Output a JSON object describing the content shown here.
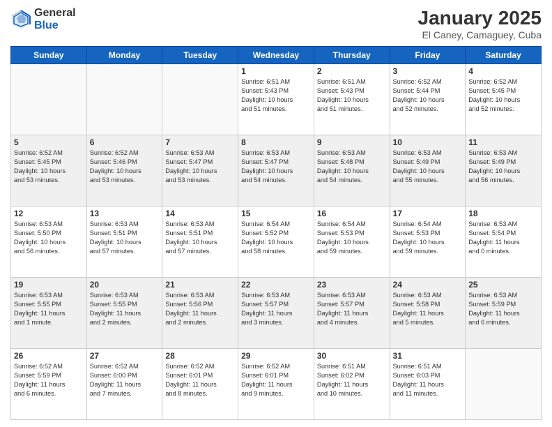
{
  "header": {
    "logo_general": "General",
    "logo_blue": "Blue",
    "month_title": "January 2025",
    "location": "El Caney, Camaguey, Cuba"
  },
  "weekdays": [
    "Sunday",
    "Monday",
    "Tuesday",
    "Wednesday",
    "Thursday",
    "Friday",
    "Saturday"
  ],
  "weeks": [
    [
      {
        "day": "",
        "info": ""
      },
      {
        "day": "",
        "info": ""
      },
      {
        "day": "",
        "info": ""
      },
      {
        "day": "1",
        "info": "Sunrise: 6:51 AM\nSunset: 5:43 PM\nDaylight: 10 hours\nand 51 minutes."
      },
      {
        "day": "2",
        "info": "Sunrise: 6:51 AM\nSunset: 5:43 PM\nDaylight: 10 hours\nand 51 minutes."
      },
      {
        "day": "3",
        "info": "Sunrise: 6:52 AM\nSunset: 5:44 PM\nDaylight: 10 hours\nand 52 minutes."
      },
      {
        "day": "4",
        "info": "Sunrise: 6:52 AM\nSunset: 5:45 PM\nDaylight: 10 hours\nand 52 minutes."
      }
    ],
    [
      {
        "day": "5",
        "info": "Sunrise: 6:52 AM\nSunset: 5:45 PM\nDaylight: 10 hours\nand 53 minutes."
      },
      {
        "day": "6",
        "info": "Sunrise: 6:52 AM\nSunset: 5:46 PM\nDaylight: 10 hours\nand 53 minutes."
      },
      {
        "day": "7",
        "info": "Sunrise: 6:53 AM\nSunset: 5:47 PM\nDaylight: 10 hours\nand 53 minutes."
      },
      {
        "day": "8",
        "info": "Sunrise: 6:53 AM\nSunset: 5:47 PM\nDaylight: 10 hours\nand 54 minutes."
      },
      {
        "day": "9",
        "info": "Sunrise: 6:53 AM\nSunset: 5:48 PM\nDaylight: 10 hours\nand 54 minutes."
      },
      {
        "day": "10",
        "info": "Sunrise: 6:53 AM\nSunset: 5:49 PM\nDaylight: 10 hours\nand 55 minutes."
      },
      {
        "day": "11",
        "info": "Sunrise: 6:53 AM\nSunset: 5:49 PM\nDaylight: 10 hours\nand 56 minutes."
      }
    ],
    [
      {
        "day": "12",
        "info": "Sunrise: 6:53 AM\nSunset: 5:50 PM\nDaylight: 10 hours\nand 56 minutes."
      },
      {
        "day": "13",
        "info": "Sunrise: 6:53 AM\nSunset: 5:51 PM\nDaylight: 10 hours\nand 57 minutes."
      },
      {
        "day": "14",
        "info": "Sunrise: 6:53 AM\nSunset: 5:51 PM\nDaylight: 10 hours\nand 57 minutes."
      },
      {
        "day": "15",
        "info": "Sunrise: 6:54 AM\nSunset: 5:52 PM\nDaylight: 10 hours\nand 58 minutes."
      },
      {
        "day": "16",
        "info": "Sunrise: 6:54 AM\nSunset: 5:53 PM\nDaylight: 10 hours\nand 59 minutes."
      },
      {
        "day": "17",
        "info": "Sunrise: 6:54 AM\nSunset: 5:53 PM\nDaylight: 10 hours\nand 59 minutes."
      },
      {
        "day": "18",
        "info": "Sunrise: 6:53 AM\nSunset: 5:54 PM\nDaylight: 11 hours\nand 0 minutes."
      }
    ],
    [
      {
        "day": "19",
        "info": "Sunrise: 6:53 AM\nSunset: 5:55 PM\nDaylight: 11 hours\nand 1 minute."
      },
      {
        "day": "20",
        "info": "Sunrise: 6:53 AM\nSunset: 5:55 PM\nDaylight: 11 hours\nand 2 minutes."
      },
      {
        "day": "21",
        "info": "Sunrise: 6:53 AM\nSunset: 5:56 PM\nDaylight: 11 hours\nand 2 minutes."
      },
      {
        "day": "22",
        "info": "Sunrise: 6:53 AM\nSunset: 5:57 PM\nDaylight: 11 hours\nand 3 minutes."
      },
      {
        "day": "23",
        "info": "Sunrise: 6:53 AM\nSunset: 5:57 PM\nDaylight: 11 hours\nand 4 minutes."
      },
      {
        "day": "24",
        "info": "Sunrise: 6:53 AM\nSunset: 5:58 PM\nDaylight: 11 hours\nand 5 minutes."
      },
      {
        "day": "25",
        "info": "Sunrise: 6:53 AM\nSunset: 5:59 PM\nDaylight: 11 hours\nand 6 minutes."
      }
    ],
    [
      {
        "day": "26",
        "info": "Sunrise: 6:52 AM\nSunset: 5:59 PM\nDaylight: 11 hours\nand 6 minutes."
      },
      {
        "day": "27",
        "info": "Sunrise: 6:52 AM\nSunset: 6:00 PM\nDaylight: 11 hours\nand 7 minutes."
      },
      {
        "day": "28",
        "info": "Sunrise: 6:52 AM\nSunset: 6:01 PM\nDaylight: 11 hours\nand 8 minutes."
      },
      {
        "day": "29",
        "info": "Sunrise: 6:52 AM\nSunset: 6:01 PM\nDaylight: 11 hours\nand 9 minutes."
      },
      {
        "day": "30",
        "info": "Sunrise: 6:51 AM\nSunset: 6:02 PM\nDaylight: 11 hours\nand 10 minutes."
      },
      {
        "day": "31",
        "info": "Sunrise: 6:51 AM\nSunset: 6:03 PM\nDaylight: 11 hours\nand 11 minutes."
      },
      {
        "day": "",
        "info": ""
      }
    ]
  ]
}
